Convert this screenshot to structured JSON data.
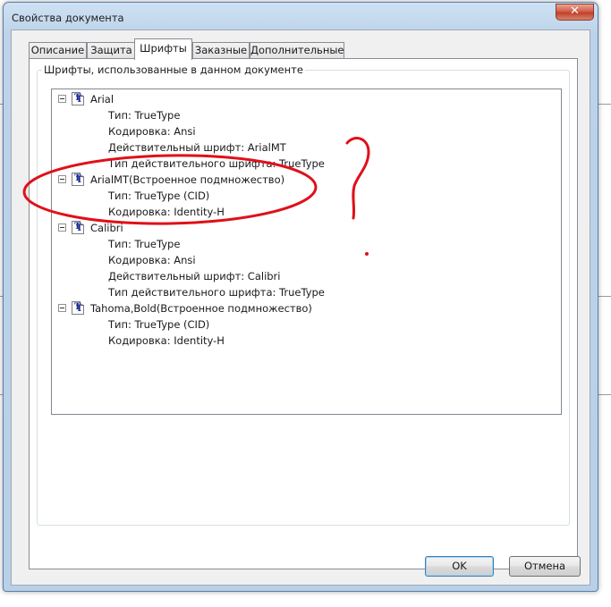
{
  "window": {
    "title": "Свойства документа",
    "close_glyph": "✕"
  },
  "tabs": [
    {
      "label": "Описание",
      "active": false
    },
    {
      "label": "Защита",
      "active": false
    },
    {
      "label": "Шрифты",
      "active": true
    },
    {
      "label": "Заказные",
      "active": false
    },
    {
      "label": "Дополнительные",
      "active": false
    }
  ],
  "fonts_group": {
    "label": "Шрифты, использованные в данном документе"
  },
  "fonts": [
    {
      "name": "Arial",
      "props": [
        "Тип: TrueType",
        "Кодировка: Ansi",
        "Действительный шрифт: ArialMT",
        "Тип действительного шрифта: TrueType"
      ]
    },
    {
      "name": "ArialMT(Встроенное подмножество)",
      "props": [
        "Тип: TrueType (CID)",
        "Кодировка: Identity-H"
      ]
    },
    {
      "name": "Calibri",
      "props": [
        "Тип: TrueType",
        "Кодировка: Ansi",
        "Действительный шрифт: Calibri",
        "Тип действительного шрифта: TrueType"
      ]
    },
    {
      "name": "Tahoma,Bold(Встроенное подмножество)",
      "props": [
        "Тип: TrueType (CID)",
        "Кодировка: Identity-H"
      ]
    }
  ],
  "buttons": {
    "ok": "OK",
    "cancel": "Отмена"
  },
  "icons": {
    "font_node": "truetype-font-icon",
    "expander": "collapse-minus-icon",
    "close": "close-icon"
  },
  "colors": {
    "annotation": "#e0101a",
    "close_button": "#c2402a",
    "icon_letter": "#1c2d8f"
  }
}
